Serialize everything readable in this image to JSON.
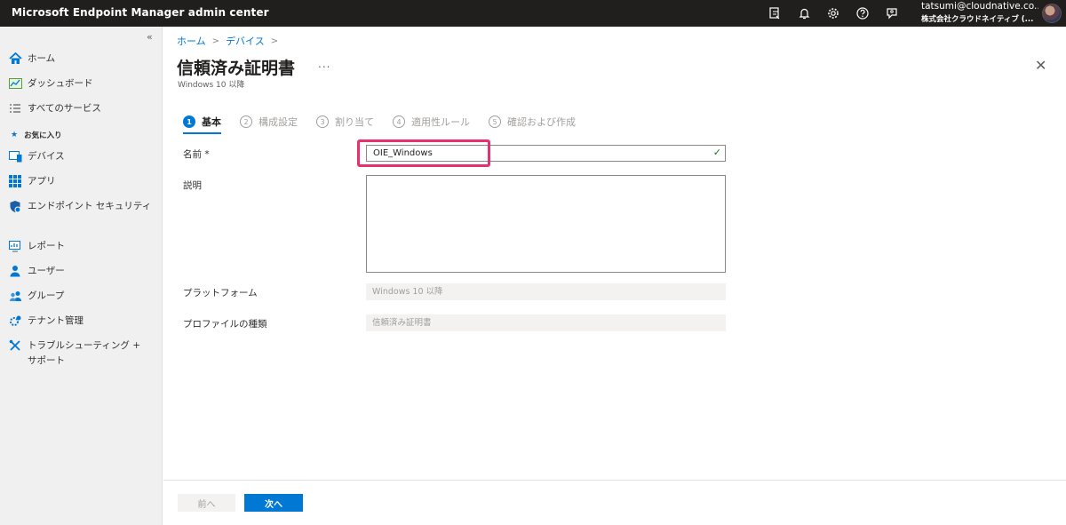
{
  "topbar": {
    "app_title": "Microsoft Endpoint Manager admin center",
    "user_email": "tatsumi@cloudnative.co...",
    "user_org": "株式会社クラウドネイティブ (..."
  },
  "sidebar": {
    "collapse": "«",
    "favorites_label": "お気に入り",
    "items": [
      {
        "label": "ホーム",
        "icon": "home-icon"
      },
      {
        "label": "ダッシュボード",
        "icon": "dashboard-icon"
      },
      {
        "label": "すべてのサービス",
        "icon": "list-icon"
      },
      {
        "label": "デバイス",
        "icon": "device-icon"
      },
      {
        "label": "アプリ",
        "icon": "apps-grid-icon"
      },
      {
        "label": "エンドポイント セキュリティ",
        "icon": "shield-icon"
      },
      {
        "label": "レポート",
        "icon": "report-icon"
      },
      {
        "label": "ユーザー",
        "icon": "user-icon"
      },
      {
        "label": "グループ",
        "icon": "group-icon"
      },
      {
        "label": "テナント管理",
        "icon": "tenant-admin-icon"
      },
      {
        "label": "トラブルシューティング + サポート",
        "icon": "troubleshoot-icon"
      }
    ]
  },
  "breadcrumb": {
    "home": "ホーム",
    "devices": "デバイス",
    "sep": ">"
  },
  "page": {
    "title": "信頼済み証明書",
    "more": "...",
    "subtitle": "Windows 10 以降",
    "close": "✕"
  },
  "steps": [
    {
      "num": "1",
      "label": "基本",
      "active": true
    },
    {
      "num": "2",
      "label": "構成設定"
    },
    {
      "num": "3",
      "label": "割り当て"
    },
    {
      "num": "4",
      "label": "適用性ルール"
    },
    {
      "num": "5",
      "label": "確認および作成"
    }
  ],
  "form": {
    "name_label": "名前 *",
    "name_value": "OIE_Windows",
    "description_label": "説明",
    "description_value": "",
    "platform_label": "プラットフォーム",
    "platform_value": "Windows 10 以降",
    "profile_type_label": "プロファイルの種類",
    "profile_type_value": "信頼済み証明書"
  },
  "footer": {
    "prev_label": "前へ",
    "next_label": "次へ"
  },
  "colors": {
    "accent": "#0078d4",
    "topbar": "#201f1e",
    "highlight": "#e8306e",
    "valid": "#107c10"
  }
}
